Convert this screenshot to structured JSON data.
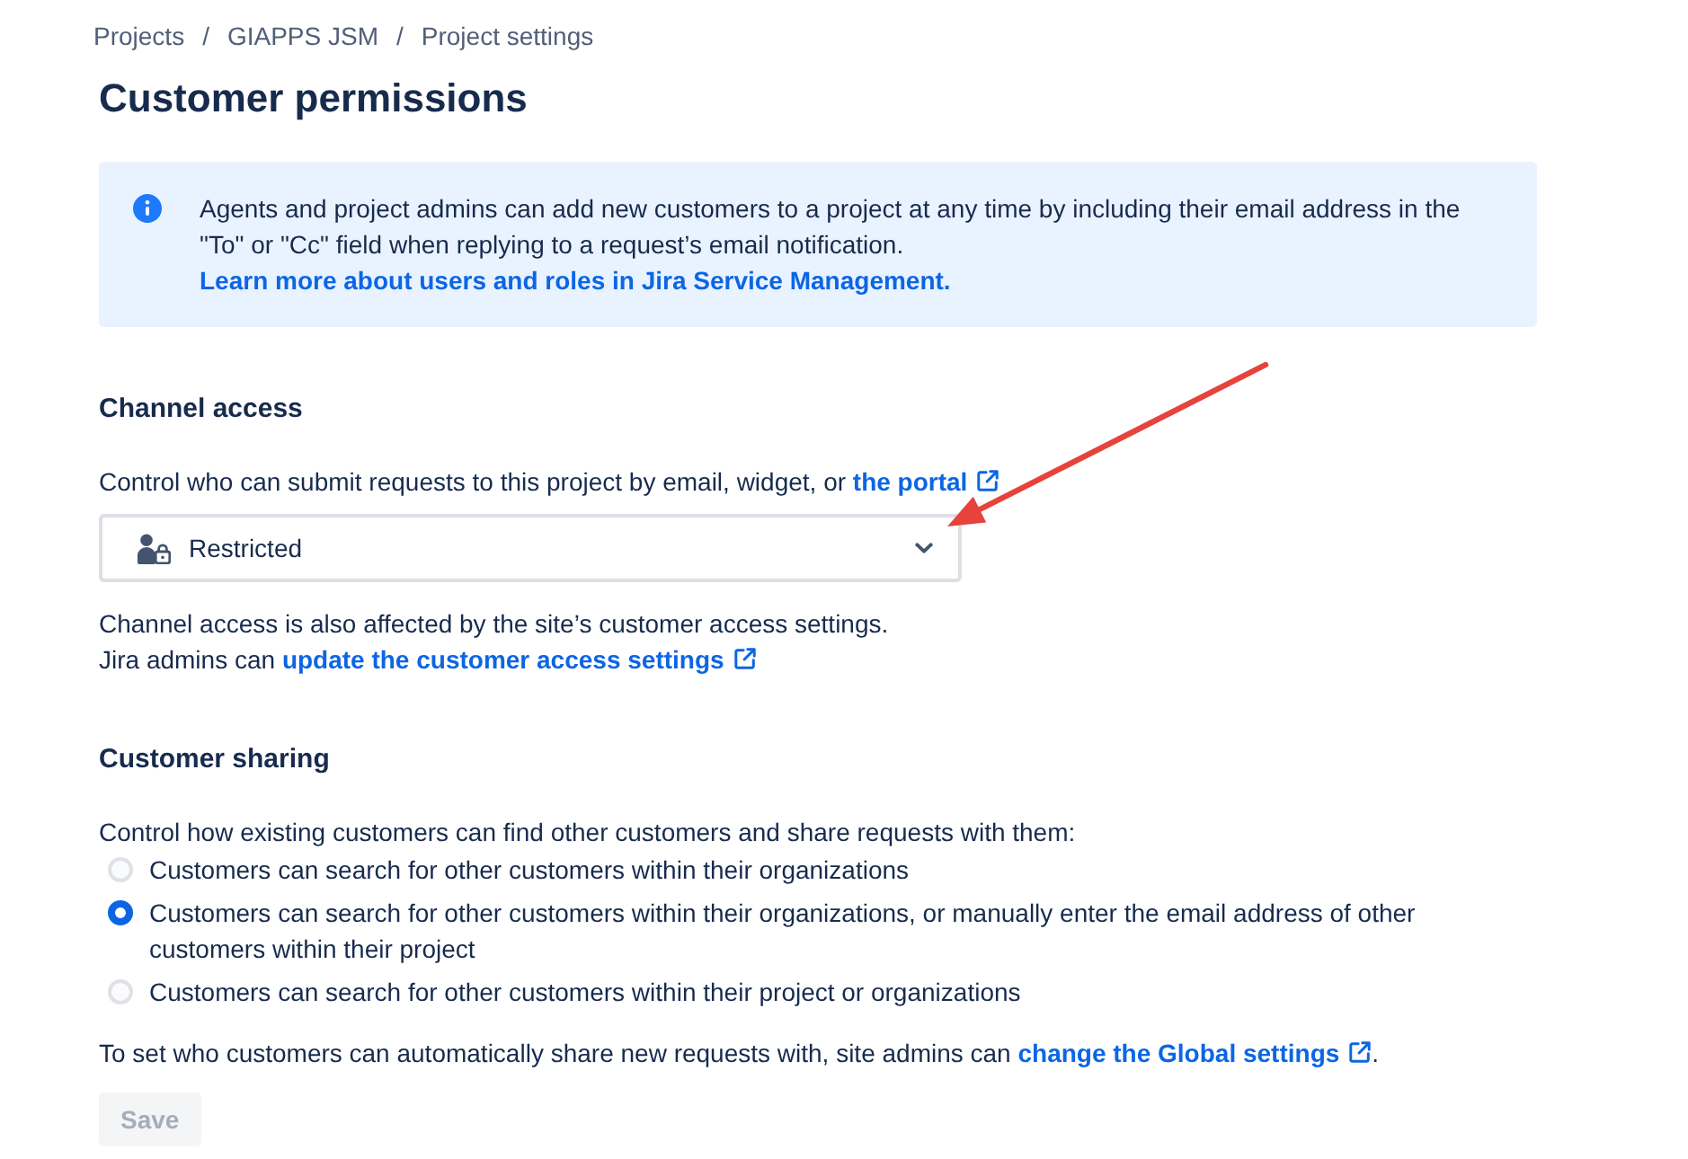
{
  "breadcrumbs": [
    {
      "label": "Projects",
      "separator": "/"
    },
    {
      "label": "GIAPPS JSM",
      "separator": "/"
    },
    {
      "label": "Project settings"
    }
  ],
  "title": "Customer permissions",
  "info_banner": {
    "text": "Agents and project admins can add new customers to a project at any time by including their email address in the \"To\" or \"Cc\" field when replying to a request’s email notification.",
    "link": {
      "label": "Learn more about users and roles in Jira Service Management.",
      "external": false
    }
  },
  "channel_access": {
    "heading": "Channel access",
    "description": {
      "text": "Control who can submit requests to this project by email, widget, or ",
      "link": {
        "label": "the portal",
        "external": true
      }
    },
    "select": {
      "value": "Restricted"
    },
    "notes": [
      {
        "text": "Channel access is also affected by the site’s customer access settings."
      },
      {
        "text": "Jira admins can ",
        "link": {
          "label": "update the customer access settings",
          "external": true
        }
      }
    ]
  },
  "customer_sharing": {
    "heading": "Customer sharing",
    "description": {
      "text": "Control how existing customers can find other customers and share requests with them:"
    },
    "options": [
      {
        "label": "Customers can search for other customers within their organizations",
        "selected": false
      },
      {
        "label": "Customers can search for other customers within their organizations, or manually enter the email address of other customers within their project",
        "selected": true
      },
      {
        "label": "Customers can search for other customers within their project or organizations",
        "selected": false
      }
    ],
    "footer": {
      "text": "To set who customers can automatically share new requests with, site admins can ",
      "link": {
        "label": "change the Global settings",
        "external": true
      },
      "after": "."
    }
  },
  "save_button": {
    "label": "Save",
    "disabled": true
  },
  "annotations": [
    {
      "kind": "arrow"
    }
  ]
}
